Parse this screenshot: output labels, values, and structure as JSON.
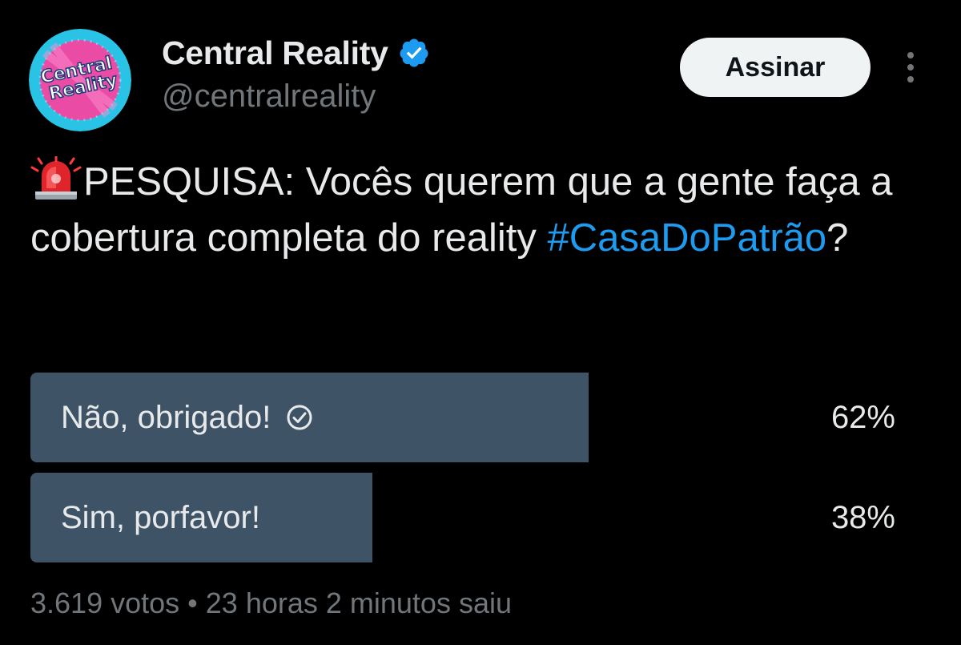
{
  "author": {
    "display_name": "Central Reality",
    "handle": "@centralreality",
    "avatar_text_line1": "Central",
    "avatar_text_line2": "Reality",
    "verified": true,
    "verified_color": "#1d9bf0"
  },
  "actions": {
    "subscribe_label": "Assinar",
    "more_icon": "more-vertical-icon"
  },
  "tweet": {
    "emoji_icon": "police-siren-icon",
    "text_main": "PESQUISA: Vocês querem que a gente faça a cobertura completa do reality ",
    "hashtag": "#CasaDoPatrão",
    "text_end": "?"
  },
  "poll": {
    "options": [
      {
        "label": "Não, obrigado!",
        "percent": "62%",
        "fraction": 0.62,
        "selected": true,
        "check_icon": "check-circle-icon"
      },
      {
        "label": "Sim, porfavor!",
        "percent": "38%",
        "fraction": 0.38,
        "selected": false
      }
    ],
    "votes": "3.619 votos",
    "separator": "•",
    "time_left": "23 horas 2 minutos saiu"
  },
  "colors": {
    "background": "#000000",
    "text": "#e7e9ea",
    "muted": "#71767b",
    "accent": "#1d9bf0",
    "poll_bar": "#3e5466",
    "avatar_bg": "#29c3e6",
    "avatar_center": "#e94ba5"
  }
}
